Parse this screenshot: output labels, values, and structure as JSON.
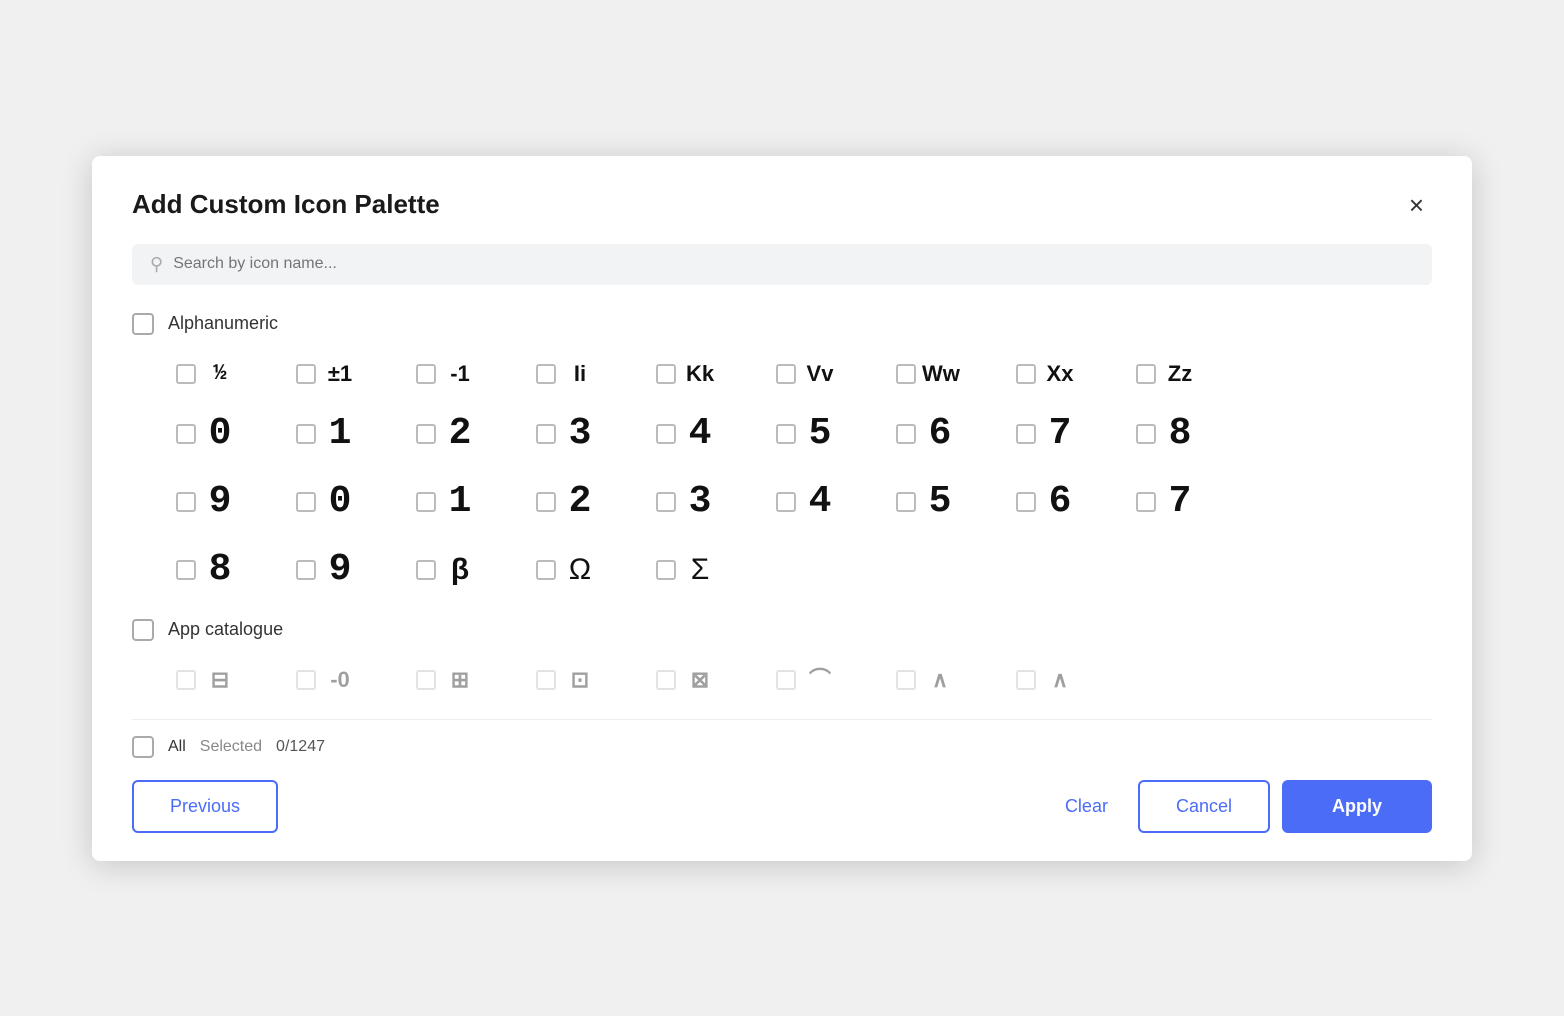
{
  "dialog": {
    "title": "Add Custom Icon Palette",
    "close_label": "×"
  },
  "search": {
    "placeholder": "Search by icon name..."
  },
  "sections": [
    {
      "id": "alphanumeric",
      "label": "Alphanumeric",
      "rows": [
        [
          {
            "glyph": "½",
            "style": "subscript-style"
          },
          {
            "glyph": "±1",
            "style": "small"
          },
          {
            "glyph": "-1",
            "style": "small"
          },
          {
            "glyph": "Ii",
            "style": "small"
          },
          {
            "glyph": "Kk",
            "style": "small"
          },
          {
            "glyph": "Vv",
            "style": "small"
          },
          {
            "glyph": "Ww",
            "style": "small"
          },
          {
            "glyph": "Xx",
            "style": "small"
          },
          {
            "glyph": "Zz",
            "style": "small"
          }
        ],
        [
          {
            "glyph": "0",
            "style": "bold-digit"
          },
          {
            "glyph": "1",
            "style": "bold-digit"
          },
          {
            "glyph": "2",
            "style": "bold-digit"
          },
          {
            "glyph": "3",
            "style": "bold-digit"
          },
          {
            "glyph": "4",
            "style": "bold-digit"
          },
          {
            "glyph": "5",
            "style": "bold-digit"
          },
          {
            "glyph": "6",
            "style": "bold-digit"
          },
          {
            "glyph": "7",
            "style": "bold-digit"
          },
          {
            "glyph": "8",
            "style": "bold-digit"
          }
        ],
        [
          {
            "glyph": "9",
            "style": "bold-digit"
          },
          {
            "glyph": "0",
            "style": "bold-digit"
          },
          {
            "glyph": "1",
            "style": "bold-digit"
          },
          {
            "glyph": "2",
            "style": "bold-digit"
          },
          {
            "glyph": "3",
            "style": "bold-digit"
          },
          {
            "glyph": "4",
            "style": "bold-digit"
          },
          {
            "glyph": "5",
            "style": "bold-digit"
          },
          {
            "glyph": "6",
            "style": "bold-digit"
          },
          {
            "glyph": "7",
            "style": "bold-digit"
          }
        ],
        [
          {
            "glyph": "8",
            "style": "bold-digit"
          },
          {
            "glyph": "9",
            "style": "bold-digit"
          },
          {
            "glyph": "β",
            "style": "icon-glyph"
          },
          {
            "glyph": "Ω",
            "style": "icon-glyph"
          },
          {
            "glyph": "Σ",
            "style": "icon-glyph"
          }
        ]
      ]
    },
    {
      "id": "app-catalogue",
      "label": "App catalogue",
      "faded": true
    }
  ],
  "footer": {
    "all_label": "All",
    "selected_label": "Selected",
    "count": "0/1247"
  },
  "actions": {
    "previous_label": "Previous",
    "clear_label": "Clear",
    "cancel_label": "Cancel",
    "apply_label": "Apply"
  }
}
